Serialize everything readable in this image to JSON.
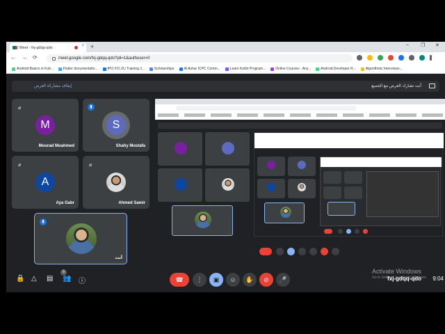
{
  "browser": {
    "tab_title": "Meet - fxj-gdqq-qdo",
    "tab_close": "×",
    "new_tab": "+",
    "url": "meet.google.com/fxj-gdqq-qdo?pli=1&authuser=0",
    "window_controls": [
      "–",
      "❐",
      "✕"
    ],
    "nav": [
      "←",
      "→",
      "⟳"
    ],
    "bookmarks": [
      {
        "label": "Android Basics in Kotl...",
        "color": "#3ddc84"
      },
      {
        "label": "Flutter documentatio...",
        "color": "#42a5f5"
      },
      {
        "label": "IPO FCI ZU Training J...",
        "color": "#1a73e8"
      },
      {
        "label": "Scholarships",
        "color": "#4285f4"
      },
      {
        "label": "Al Azhar ICPC Comm...",
        "color": "#1877f2"
      },
      {
        "label": "Learn Kotlin Program...",
        "color": "#7f52ff"
      },
      {
        "label": "Online Courses - Any...",
        "color": "#a435f0"
      },
      {
        "label": "Android Developer R...",
        "color": "#3ddc84"
      },
      {
        "label": "Algorithmic Interviews...",
        "color": "#fbbc04"
      }
    ]
  },
  "meet": {
    "stop_sharing": "إيقاف مشاركة العرض",
    "sharing_message": "أنت تشارك العرض مع الجميع",
    "participants": [
      {
        "name": "Mourad Moahmed",
        "initial": "M",
        "color": "#7b1fa2",
        "state": "muted"
      },
      {
        "name": "Shahy Mostafa",
        "initial": "S",
        "color": "#5c6bc0",
        "state": "speaking"
      },
      {
        "name": "Aya Gabr",
        "initial": "A",
        "color": "#0d47a1",
        "state": "muted"
      },
      {
        "name": "Ahmed Samir",
        "initial": "",
        "color": "",
        "state": "muted"
      },
      {
        "name": "أنت",
        "initial": "",
        "color": "",
        "state": "speaking"
      }
    ],
    "participant_count": "6",
    "meeting_code": "fxj-gdqq-qdo",
    "time": "9:04",
    "mic_muted_glyph": "🎤",
    "speaking_glyph": "▮▮▮"
  },
  "controls": {
    "left_icons": [
      "🔒",
      "△",
      "▤",
      "👥",
      "ⓘ"
    ],
    "end_call": "☎",
    "more": "⋮",
    "present": "▣",
    "emoji": "☺",
    "raise_hand": "✋",
    "camera_off": "⊘",
    "mic": "🎤"
  },
  "watermark": {
    "title": "Activate Windows",
    "subtitle": "Go to Settings to activate Windows."
  }
}
